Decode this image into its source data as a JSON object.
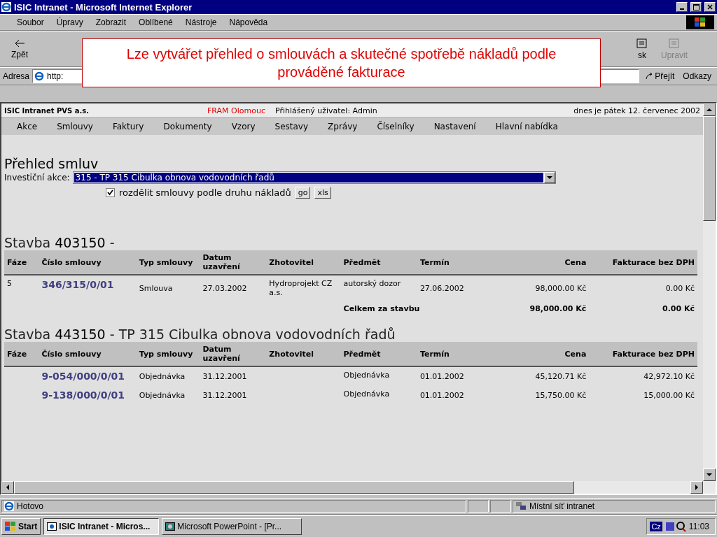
{
  "window": {
    "title": "ISIC Intranet - Microsoft Internet Explorer"
  },
  "menu": [
    "Soubor",
    "Úpravy",
    "Zobrazit",
    "Oblíbené",
    "Nástroje",
    "Nápověda"
  ],
  "toolbar": [
    {
      "label": "Zpět",
      "disabled": false
    },
    {
      "label": "sk",
      "disabled": false
    },
    {
      "label": "Upravit",
      "disabled": true
    }
  ],
  "address": {
    "label": "Adresa",
    "value": "http:",
    "go": "Přejít",
    "links": "Odkazy"
  },
  "callout": "Lze vytvářet přehled o smlouvách a skutečné spotřebě nákladů podle prováděné fakturace",
  "page_header": {
    "org": "ISIC Intranet PVS a.s.",
    "location": "FRAM Olomouc",
    "user": "Přihlášený uživatel: Admin",
    "date": "dnes je pátek 12. červenec 2002"
  },
  "nav": [
    "Akce",
    "Smlouvy",
    "Faktury",
    "Dokumenty",
    "Vzory",
    "Sestavy",
    "Zprávy",
    "Číselníky",
    "Nastavení",
    "Hlavní nabídka"
  ],
  "heading": "Přehled smluv",
  "filter": {
    "label": "Investiční akce:",
    "value": "315 - TP 315 Cibulka obnova vodovodních řadů",
    "checkbox_label": "rozdělit smlouvy podle druhu nákladů",
    "checked": true,
    "buttons": [
      "go",
      "xls"
    ]
  },
  "sections": [
    {
      "label": "Stavba",
      "number": "403150",
      "rest": "-",
      "columns": [
        "Fáze",
        "Číslo smlouvy",
        "Typ smlouvy",
        "Datum uzavření",
        "Zhotovitel",
        "Předmět",
        "Termín",
        "Cena",
        "Fakturace bez DPH"
      ],
      "rows": [
        [
          "5",
          "346/315/0/01",
          "Smlouva",
          "27.03.2002",
          "Hydroprojekt CZ a.s.",
          "autorský dozor",
          "27.06.2002",
          "98,000.00 Kč",
          "0.00 Kč"
        ]
      ],
      "total": {
        "label": "Celkem za stavbu",
        "price": "98,000.00 Kč",
        "invoiced": "0.00 Kč"
      }
    },
    {
      "label": "Stavba",
      "number": "443150",
      "rest": "- TP 315 Cibulka obnova vodovodních řadů",
      "columns": [
        "Fáze",
        "Číslo smlouvy",
        "Typ smlouvy",
        "Datum uzavření",
        "Zhotovitel",
        "Předmět",
        "Termín",
        "Cena",
        "Fakturace bez DPH"
      ],
      "rows": [
        [
          "",
          "9-054/000/0/01",
          "Objednávka",
          "31.12.2001",
          "",
          "Objednávka",
          "01.01.2002",
          "45,120.71 Kč",
          "42,972.10 Kč"
        ],
        [
          "",
          "9-138/000/0/01",
          "Objednávka",
          "31.12.2001",
          "",
          "Objednávka",
          "01.01.2002",
          "15,750.00 Kč",
          "15,000.00 Kč"
        ]
      ]
    }
  ],
  "status_bar": {
    "text": "Hotovo",
    "zone": "Místní síť intranet"
  },
  "taskbar": {
    "start": "Start",
    "tasks": [
      {
        "label": "ISIC Intranet - Micros...",
        "selected": true
      },
      {
        "label": "Microsoft PowerPoint - [Pr...",
        "selected": false
      }
    ],
    "lang": "Cz",
    "clock": "11:03"
  }
}
